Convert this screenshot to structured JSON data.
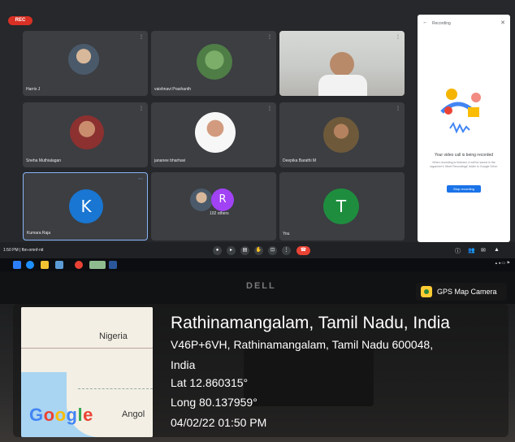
{
  "meet": {
    "rec_badge": "REC",
    "meeting_info": "1:50 PM  |  fbn-omnf-nit",
    "participants": [
      {
        "name": "Harris J"
      },
      {
        "name": "vaishnavi Prashanth"
      },
      {
        "name": ""
      },
      {
        "name": "Sneha Muthialagan"
      },
      {
        "name": "jananee bharhavi"
      },
      {
        "name": "Deepika Barathi M"
      },
      {
        "name": "Kumara Raja",
        "initial": "K",
        "color": "#1976d2"
      },
      {
        "name": "102 others",
        "initial": "R",
        "color": "#a142f4"
      },
      {
        "name": "You",
        "initial": "T",
        "color": "#1e8e3e"
      }
    ],
    "recording_panel": {
      "title": "Recording",
      "heading": "Your video call is being recorded",
      "description": "When recording is finished, it will be saved in the organizer's 'Meet Recordings' folder in Google Drive.",
      "stop_button": "Stop recording"
    }
  },
  "monitor_brand": "DELL",
  "gps": {
    "app_label": "GPS Map Camera",
    "place": "Rathinamangalam, Tamil Nadu, India",
    "address": "V46P+6VH, Rathinamangalam, Tamil Nadu 600048,",
    "country": "India",
    "lat": "Lat 12.860315°",
    "long": "Long 80.137959°",
    "datetime": "04/02/22 01:50 PM",
    "map": {
      "label_nigeria": "Nigeria",
      "label_angola": "Angol",
      "google_logo": "Google"
    }
  }
}
